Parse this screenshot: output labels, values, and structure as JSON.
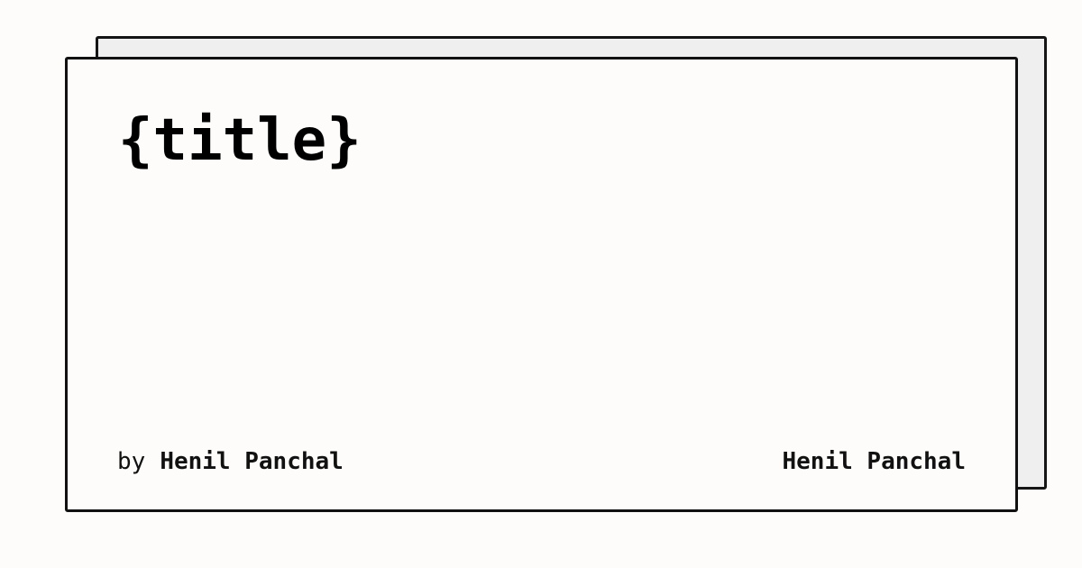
{
  "title": "{title}",
  "byline": {
    "prefix": "by",
    "author": "Henil Panchal"
  },
  "site_name": "Henil Panchal",
  "colors": {
    "background": "#fdfcfa",
    "shadow_card": "#efefef",
    "border": "#111111",
    "text": "#000000"
  }
}
